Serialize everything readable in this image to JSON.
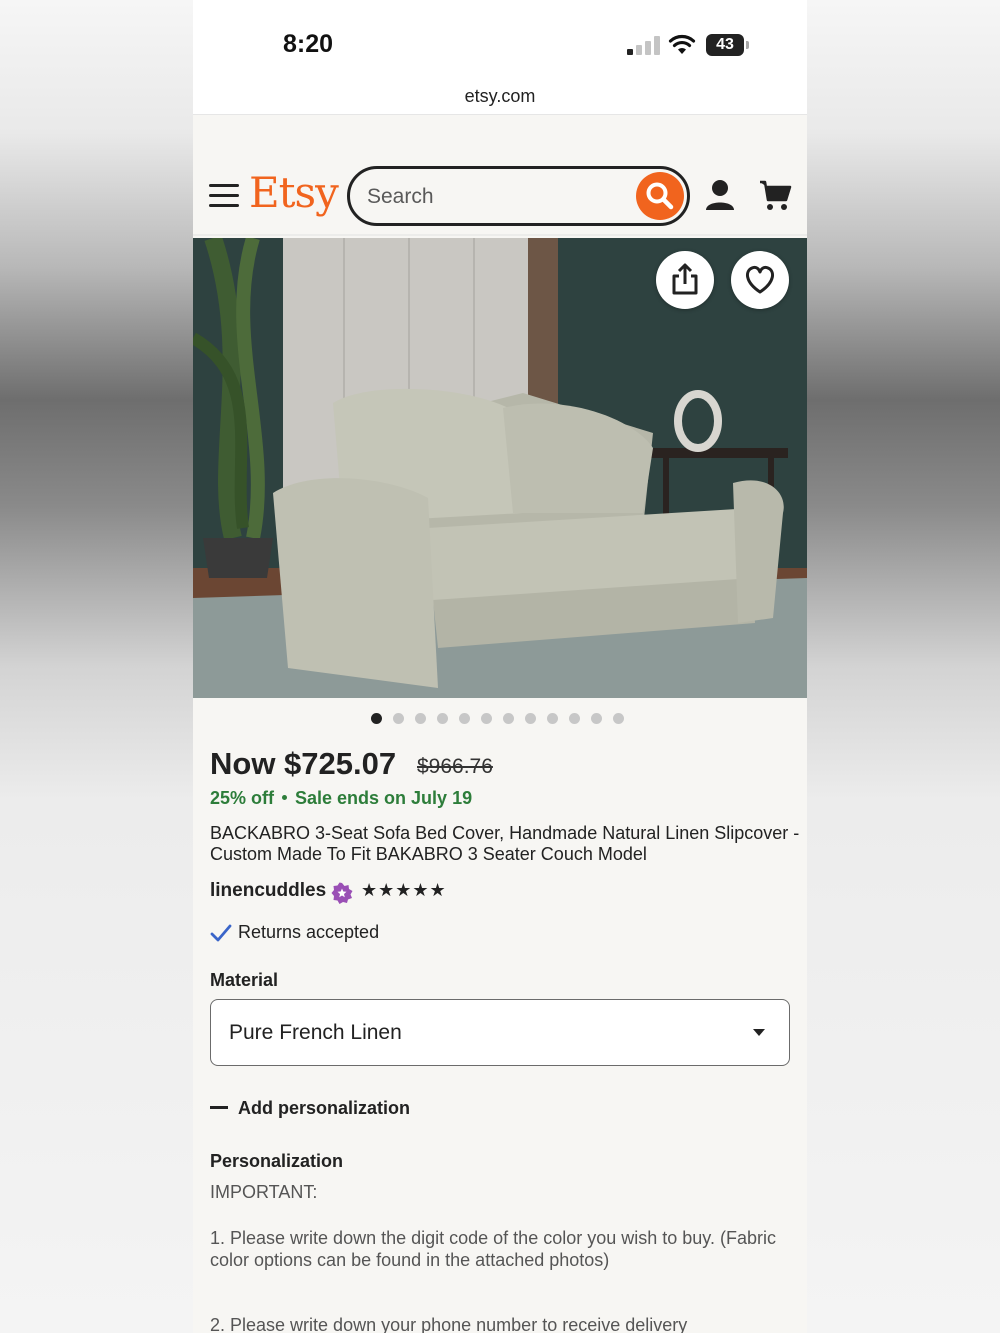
{
  "status_bar": {
    "time": "8:20",
    "battery": "43"
  },
  "browser": {
    "url": "etsy.com"
  },
  "header": {
    "logo": "Etsy",
    "search_placeholder": "Search",
    "menu_icon": "hamburger-menu-icon",
    "search_icon": "magnifier-icon",
    "user_icon": "person-icon",
    "cart_icon": "shopping-cart-icon",
    "brand_color": "#f1641e"
  },
  "gallery": {
    "image_count": 12,
    "active_index": 0,
    "share_icon": "share-icon",
    "favorite_icon": "heart-icon"
  },
  "product": {
    "price_now": "Now $725.07",
    "price_original": "$966.76",
    "discount": "25% off",
    "sale_ends": "Sale ends on July 19",
    "title": "BACKABRO 3-Seat Sofa Bed Cover, Handmade Natural Linen Slipcover - Custom Made To Fit BAKABRO 3 Seater Couch Model",
    "shop_name": "linencuddles",
    "rating_stars": "★★★★★",
    "rating": 5,
    "returns": "Returns accepted"
  },
  "options": {
    "material_label": "Material",
    "material_value": "Pure French Linen",
    "add_personalization": "Add personalization",
    "personalization_label": "Personalization",
    "important": "IMPORTANT:",
    "instruction_1": "1. Please write down the digit code of the color you wish to buy. (Fabric color options can be found in the attached photos)",
    "instruction_2": "2. Please write down your phone number to receive delivery"
  }
}
